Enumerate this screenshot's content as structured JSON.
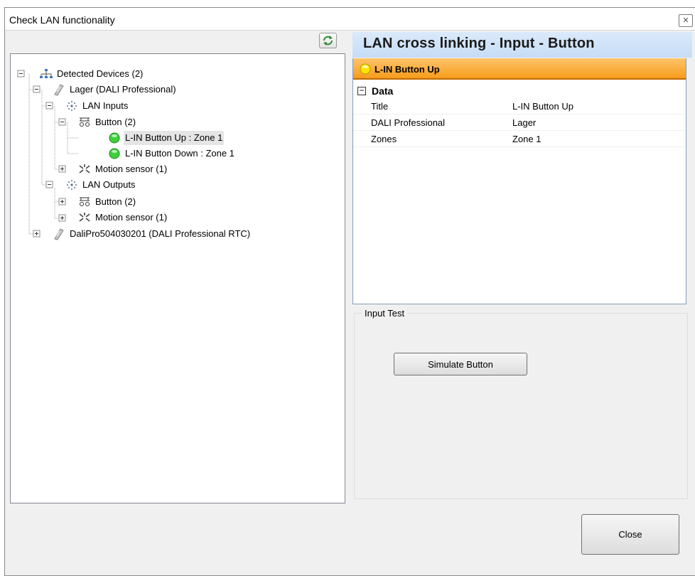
{
  "window": {
    "title": "Check LAN functionality",
    "close_glyph": "✕"
  },
  "toolbar": {
    "refresh_icon": "refresh-icon"
  },
  "tree": {
    "root": "Detected Devices (2)",
    "device1": "Lager (DALI Professional)",
    "lan_inputs": "LAN Inputs",
    "button_in": "Button (2)",
    "btn_up": "L-IN Button Up : Zone 1",
    "btn_down": "L-IN Button Down : Zone 1",
    "motion_in": "Motion sensor (1)",
    "lan_outputs": "LAN Outputs",
    "button_out": "Button (2)",
    "motion_out": "Motion sensor (1)",
    "device2": "DaliPro504030201 (DALI Professional RTC)"
  },
  "detail": {
    "header": "LAN cross linking - Input - Button",
    "item_title": "L-IN Button Up",
    "category": "Data",
    "category_toggle": "−",
    "rows": [
      {
        "key": "Title",
        "value": "L-IN Button Up"
      },
      {
        "key": "DALI Professional",
        "value": "Lager"
      },
      {
        "key": "Zones",
        "value": "Zone 1"
      }
    ]
  },
  "input_test": {
    "label": "Input Test",
    "simulate_label": "Simulate Button"
  },
  "footer": {
    "close_label": "Close"
  },
  "colors": {
    "header_blue": "#c6dcf6",
    "item_orange": "#f79c1c",
    "status_green": "#3fcf3f",
    "bulb_yellow": "#ffe600"
  }
}
